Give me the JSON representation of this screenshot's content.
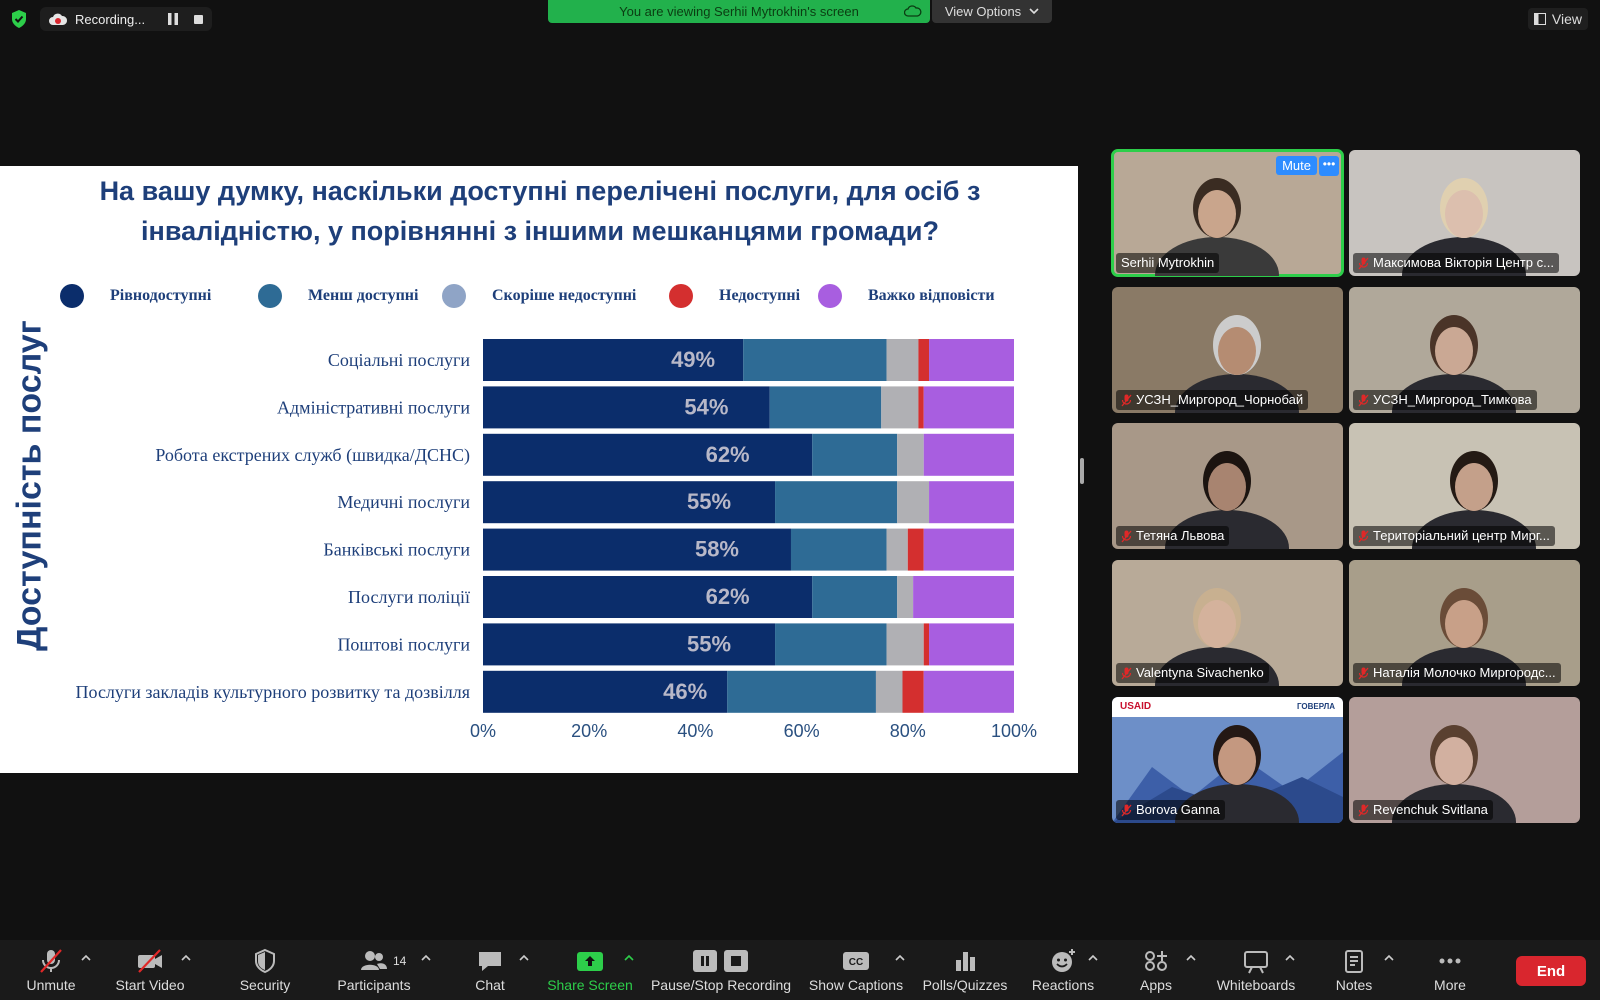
{
  "topbar": {
    "recording_label": "Recording...",
    "viewing_banner": "You are viewing Serhii Mytrokhin's screen",
    "view_options": "View Options",
    "view_button": "View"
  },
  "slide": {
    "title_line1": "На вашу думку, наскільки доступні перелічені послуги, для осіб з",
    "title_line2": "інвалідністю, у порівнянні з іншими мешканцями громади?",
    "y_axis_label": "Доступність послуг",
    "legend": [
      {
        "label": "Рівнодоступні",
        "color": "#0b2d6b"
      },
      {
        "label": "Менш доступні",
        "color": "#2e6b95"
      },
      {
        "label": "Скоріше недоступні",
        "color": "#8fa4c6"
      },
      {
        "label": "Недоступні",
        "color": "#d42f2f"
      },
      {
        "label": "Важко відповісти",
        "color": "#a85ee0"
      }
    ]
  },
  "chart_data": {
    "type": "bar",
    "orientation": "horizontal",
    "stacked": true,
    "categories": [
      "Соціальні послуги",
      "Адміністративні послуги",
      "Робота екстрених служб (швидка/ДСНС)",
      "Медичні послуги",
      "Банківські послуги",
      "Послуги поліції",
      "Поштові послуги",
      "Послуги закладів культурного розвитку та дозвілля"
    ],
    "series": [
      {
        "name": "Рівнодоступні",
        "color": "#0b2d6b",
        "values": [
          49,
          54,
          62,
          55,
          58,
          62,
          55,
          46
        ]
      },
      {
        "name": "Менш доступні",
        "color": "#2e6b95",
        "values": [
          27,
          21,
          16,
          23,
          18,
          16,
          21,
          28
        ]
      },
      {
        "name": "Скоріше недоступні",
        "color": "#b0b0b4",
        "values": [
          6,
          7,
          5,
          6,
          4,
          3,
          7,
          5
        ]
      },
      {
        "name": "Недоступні",
        "color": "#d42f2f",
        "values": [
          2,
          1,
          0,
          0,
          3,
          0,
          1,
          4
        ]
      },
      {
        "name": "Важко відповісти",
        "color": "#a85ee0",
        "values": [
          16,
          17,
          17,
          16,
          17,
          19,
          16,
          17
        ]
      }
    ],
    "data_labels": [
      "49%",
      "54%",
      "62%",
      "55%",
      "58%",
      "62%",
      "55%",
      "46%"
    ],
    "x_ticks": [
      "0%",
      "20%",
      "40%",
      "60%",
      "80%",
      "100%"
    ],
    "xlim": [
      0,
      100
    ],
    "legend_position": "top"
  },
  "gallery": [
    {
      "name": "Serhii Mytrokhin",
      "active": true,
      "muted": false,
      "bg": "#b8a896"
    },
    {
      "name": "Максимова Вікторія Центр с...",
      "active": false,
      "muted": true,
      "bg": "#c8c4c0"
    },
    {
      "name": "УСЗН_Миргород_Чорнобай",
      "active": false,
      "muted": true,
      "bg": "#8a7a66"
    },
    {
      "name": "УСЗН_Миргород_Тимкова",
      "active": false,
      "muted": true,
      "bg": "#b0a89a"
    },
    {
      "name": "Тетяна Львова",
      "active": false,
      "muted": true,
      "bg": "#a89888"
    },
    {
      "name": "Територіальний центр Мирг...",
      "active": false,
      "muted": true,
      "bg": "#c8c2b4"
    },
    {
      "name": "Valentyna Sivachenko",
      "active": false,
      "muted": true,
      "bg": "#b8aa98"
    },
    {
      "name": "Наталія Молочко Миргородс...",
      "active": false,
      "muted": true,
      "bg": "#a89e8a"
    },
    {
      "name": "Borova Ganna",
      "active": false,
      "muted": true,
      "bg": "#6d8fc8",
      "logo_left": "USAID",
      "logo_right": "ГОВЕРЛА"
    },
    {
      "name": "Revenchuk Svitlana",
      "active": false,
      "muted": true,
      "bg": "#b49e9a"
    }
  ],
  "gallery_controls": {
    "mute": "Mute",
    "more": "•••"
  },
  "toolbar": {
    "items": [
      {
        "label": "Unmute",
        "icon": "mic-off-icon"
      },
      {
        "label": "Start Video",
        "icon": "video-off-icon"
      },
      {
        "label": "Security",
        "icon": "shield-icon"
      },
      {
        "label": "Participants",
        "icon": "participants-icon"
      },
      {
        "label": "Chat",
        "icon": "chat-icon"
      },
      {
        "label": "Share Screen",
        "icon": "share-screen-icon"
      },
      {
        "label": "Pause/Stop Recording",
        "icon": "pause-stop-icon"
      },
      {
        "label": "Show Captions",
        "icon": "captions-icon"
      },
      {
        "label": "Polls/Quizzes",
        "icon": "polls-icon"
      },
      {
        "label": "Reactions",
        "icon": "reactions-icon"
      },
      {
        "label": "Apps",
        "icon": "apps-icon"
      },
      {
        "label": "Whiteboards",
        "icon": "whiteboard-icon"
      },
      {
        "label": "Notes",
        "icon": "notes-icon"
      },
      {
        "label": "More",
        "icon": "more-icon"
      }
    ],
    "participant_count": "14",
    "captions_badge": "CC",
    "end_label": "End"
  }
}
